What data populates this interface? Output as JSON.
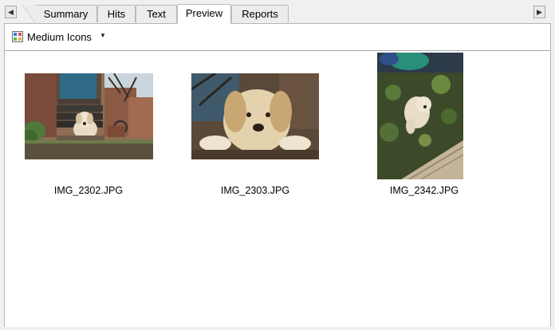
{
  "tabs": [
    {
      "label": "Summary",
      "active": false
    },
    {
      "label": "Hits",
      "active": false
    },
    {
      "label": "Text",
      "active": false
    },
    {
      "label": "Preview",
      "active": true
    },
    {
      "label": "Reports",
      "active": false
    }
  ],
  "scroll": {
    "left_glyph": "◀",
    "right_glyph": "▶"
  },
  "toolbar": {
    "view_mode": "Medium Icons",
    "dropdown_glyph": "▼"
  },
  "files": [
    {
      "name": "IMG_2302.JPG",
      "orientation": "landscape"
    },
    {
      "name": "IMG_2303.JPG",
      "orientation": "landscape"
    },
    {
      "name": "IMG_2342.JPG",
      "orientation": "portrait"
    }
  ]
}
